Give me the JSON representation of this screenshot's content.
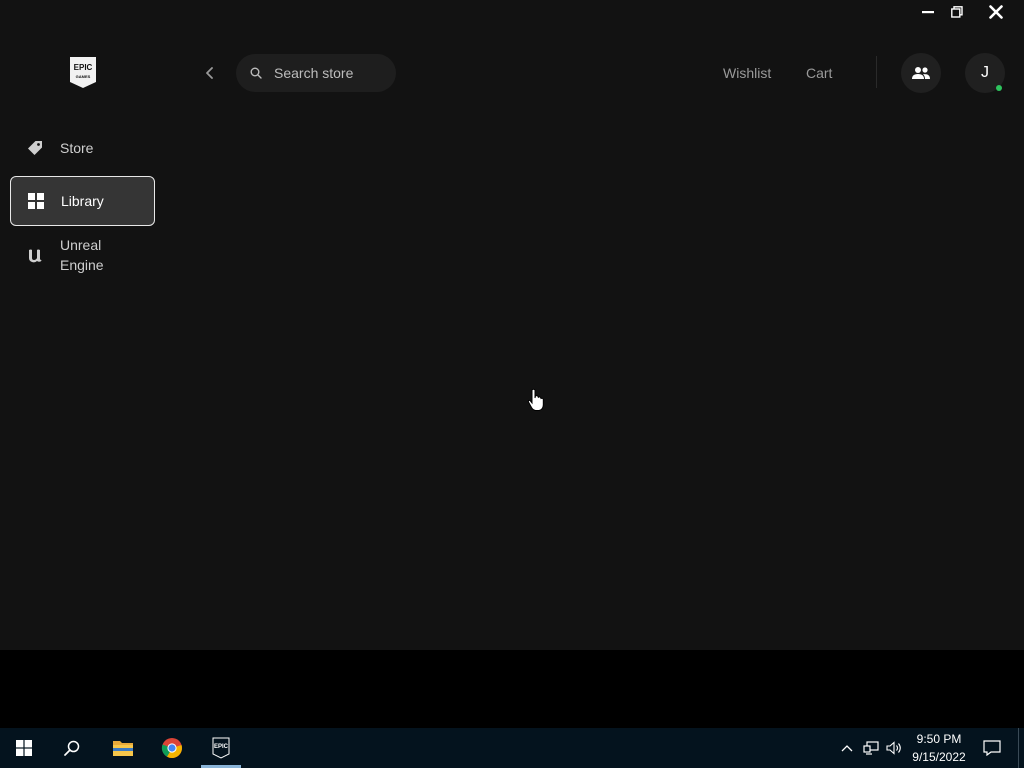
{
  "window": {
    "controls": [
      "minimize",
      "maximize",
      "close"
    ]
  },
  "sidebar": {
    "logo_text_top": "EPIC",
    "logo_text_bottom": "GAMES",
    "items": [
      {
        "label": "Store",
        "icon": "tag-icon",
        "selected": false
      },
      {
        "label": "Library",
        "icon": "grid-icon",
        "selected": true
      },
      {
        "label": "Unreal Engine",
        "icon": "unreal-engine-icon",
        "selected": false
      }
    ]
  },
  "header": {
    "search_placeholder": "Search store",
    "wishlist_label": "Wishlist",
    "cart_label": "Cart",
    "avatar_initial": "J",
    "online_status_color": "#2ec45e"
  },
  "taskbar": {
    "time": "9:50 PM",
    "date": "9/15/2022",
    "epic_icon_text": "EPIC",
    "apps": [
      "start-icon",
      "search-icon",
      "file-explorer-icon",
      "chrome-icon",
      "epic-games-icon"
    ]
  },
  "colors": {
    "app_background": "#121212",
    "selected_nav": "#353535",
    "taskbar": "#04131e"
  }
}
